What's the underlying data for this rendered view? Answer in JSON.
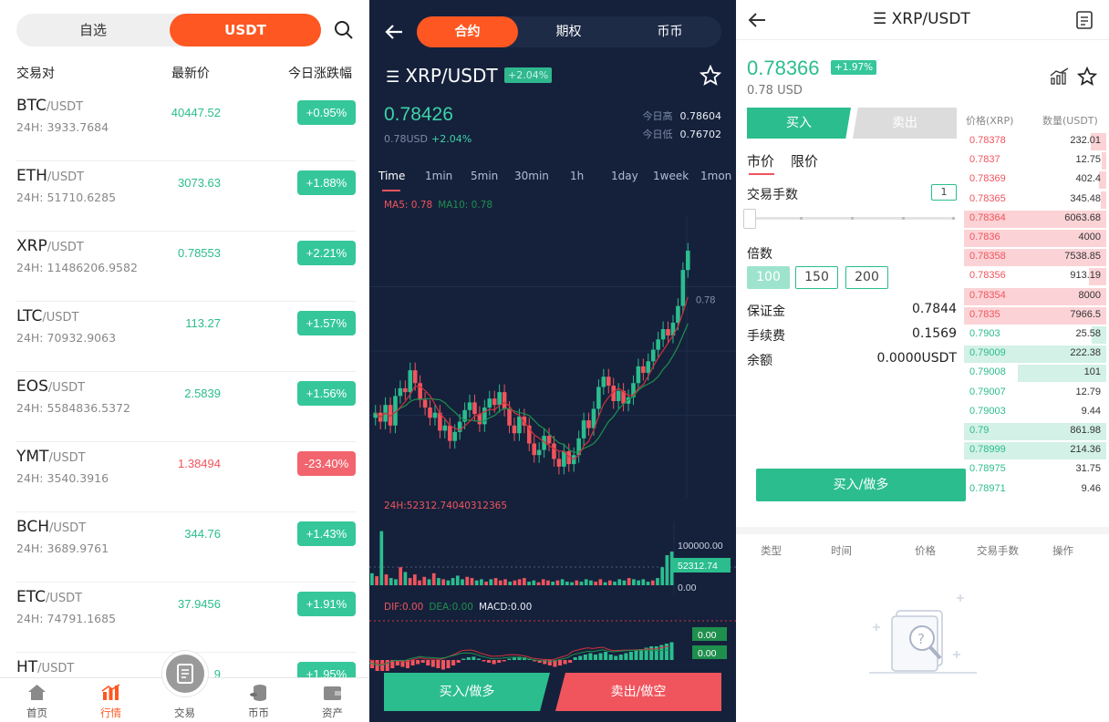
{
  "markets": {
    "tabs": [
      "自选",
      "USDT"
    ],
    "columns": [
      "交易对",
      "最新价",
      "今日涨跌幅"
    ],
    "rows": [
      {
        "base": "BTC",
        "quote": "/USDT",
        "vol": "24H: 3933.7684",
        "price": "40447.52",
        "change": "+0.95%",
        "up": true
      },
      {
        "base": "ETH",
        "quote": "/USDT",
        "vol": "24H: 51710.6285",
        "price": "3073.63",
        "change": "+1.88%",
        "up": true
      },
      {
        "base": "XRP",
        "quote": "/USDT",
        "vol": "24H: 11486206.9582",
        "price": "0.78553",
        "change": "+2.21%",
        "up": true
      },
      {
        "base": "LTC",
        "quote": "/USDT",
        "vol": "24H: 70932.9063",
        "price": "113.27",
        "change": "+1.57%",
        "up": true
      },
      {
        "base": "EOS",
        "quote": "/USDT",
        "vol": "24H: 5584836.5372",
        "price": "2.5839",
        "change": "+1.56%",
        "up": true
      },
      {
        "base": "YMT",
        "quote": "/USDT",
        "vol": "24H: 3540.3916",
        "price": "1.38494",
        "change": "-23.40%",
        "up": false
      },
      {
        "base": "BCH",
        "quote": "/USDT",
        "vol": "24H: 3689.9761",
        "price": "344.76",
        "change": "+1.43%",
        "up": true
      },
      {
        "base": "ETC",
        "quote": "/USDT",
        "vol": "24H: 74791.1685",
        "price": "37.9456",
        "change": "+1.91%",
        "up": true
      },
      {
        "base": "HT",
        "quote": "/USDT",
        "vol": "",
        "price": "9",
        "change": "+1.95%",
        "up": true
      }
    ],
    "tabbar": [
      "首页",
      "行情",
      "交易",
      "币币",
      "资产"
    ]
  },
  "chart_panel": {
    "tabs": [
      "合约",
      "期权",
      "币币"
    ],
    "pair": "XRP/USDT",
    "badge": "+2.04%",
    "price": "0.78426",
    "sub_usd": "0.78USD",
    "sub_change": "+2.04%",
    "high_label": "今日高",
    "high": "0.78604",
    "low_label": "今日低",
    "low": "0.76702",
    "timeframes": [
      "Time",
      "1min",
      "5min",
      "30min",
      "1h",
      "1day",
      "1week",
      "1mon"
    ],
    "ma5": "MA5: 0.78",
    "ma10": "MA10: 0.78",
    "axis_price": "0.78",
    "vol_label": "24H:52312.74040312365",
    "vol_axis_top": "100000.00",
    "vol_current": "52312.74",
    "vol_axis_bottom": "0.00",
    "dif": "DIF:0.00",
    "dea": "DEA:0.00",
    "macd": "MACD:0.00",
    "macd_v1": "0.00",
    "macd_v2": "0.00",
    "buy": "买入/做多",
    "sell": "卖出/做空",
    "colors": {
      "up": "#2bbd8e",
      "down": "#f0545d",
      "bg": "#15213b",
      "accent": "#fe5722"
    }
  },
  "chart_data": {
    "type": "candlestick",
    "title": "XRP/USDT",
    "ylabel": "",
    "closes": [
      0.7712,
      0.7705,
      0.7718,
      0.7702,
      0.7725,
      0.7731,
      0.7728,
      0.7745,
      0.7735,
      0.7722,
      0.7716,
      0.7708,
      0.7712,
      0.7698,
      0.7702,
      0.769,
      0.7697,
      0.7705,
      0.7714,
      0.772,
      0.7711,
      0.7703,
      0.7716,
      0.7723,
      0.7718,
      0.7728,
      0.7715,
      0.7702,
      0.7696,
      0.7709,
      0.7702,
      0.7688,
      0.7679,
      0.7683,
      0.7694,
      0.7688,
      0.7676,
      0.767,
      0.7682,
      0.7672,
      0.7679,
      0.7692,
      0.7706,
      0.77,
      0.7715,
      0.7732,
      0.774,
      0.7733,
      0.7721,
      0.7729,
      0.7719,
      0.7724,
      0.7735,
      0.7748,
      0.7743,
      0.7752,
      0.7761,
      0.7769,
      0.7777,
      0.7772,
      0.7782,
      0.7795,
      0.7823,
      0.7838
    ],
    "volume_max": 100000,
    "volume_current": 52312.74
  },
  "trade": {
    "pair": "XRP/USDT",
    "price": "0.78366",
    "badge": "+1.97%",
    "usd": "0.78 USD",
    "buy_tab": "买入",
    "sell_tab": "卖出",
    "order_types": [
      "市价",
      "限价"
    ],
    "qty_label": "交易手数",
    "qty_value": "1",
    "leverage_label": "倍数",
    "leverages": [
      "100",
      "150",
      "200"
    ],
    "margin_label": "保证金",
    "margin": "0.7844",
    "fee_label": "手续费",
    "fee": "0.1569",
    "balance_label": "余额",
    "balance": "0.0000USDT",
    "submit": "买入/做多",
    "ob_price_h": "价格(XRP)",
    "ob_qty_h": "数量(USDT)",
    "asks": [
      {
        "p": "0.78378",
        "q": "232.01",
        "w": 0.11
      },
      {
        "p": "0.7837",
        "q": "12.75",
        "w": 0.03
      },
      {
        "p": "0.78369",
        "q": "402.4",
        "w": 0.05
      },
      {
        "p": "0.78365",
        "q": "345.48",
        "w": 0.04
      },
      {
        "p": "0.78364",
        "q": "6063.68",
        "w": 1.0
      },
      {
        "p": "0.7836",
        "q": "4000",
        "w": 1.0
      },
      {
        "p": "0.78358",
        "q": "7538.85",
        "w": 1.0
      },
      {
        "p": "0.78356",
        "q": "913.19",
        "w": 0.12
      },
      {
        "p": "0.78354",
        "q": "8000",
        "w": 1.0
      },
      {
        "p": "0.7835",
        "q": "7966.5",
        "w": 1.0
      }
    ],
    "bids": [
      {
        "p": "0.7903",
        "q": "25.58",
        "w": 0.1
      },
      {
        "p": "0.79009",
        "q": "222.38",
        "w": 1.0
      },
      {
        "p": "0.79008",
        "q": "101",
        "w": 0.62
      },
      {
        "p": "0.79007",
        "q": "12.79",
        "w": 0.0
      },
      {
        "p": "0.79003",
        "q": "9.44",
        "w": 0.0
      },
      {
        "p": "0.79",
        "q": "861.98",
        "w": 1.0
      },
      {
        "p": "0.78999",
        "q": "214.36",
        "w": 1.0
      },
      {
        "p": "0.78975",
        "q": "31.75",
        "w": 0.0
      },
      {
        "p": "0.78971",
        "q": "9.46",
        "w": 0.0
      }
    ],
    "history_cols": [
      "类型",
      "时间",
      "价格",
      "交易手数",
      "操作"
    ]
  }
}
